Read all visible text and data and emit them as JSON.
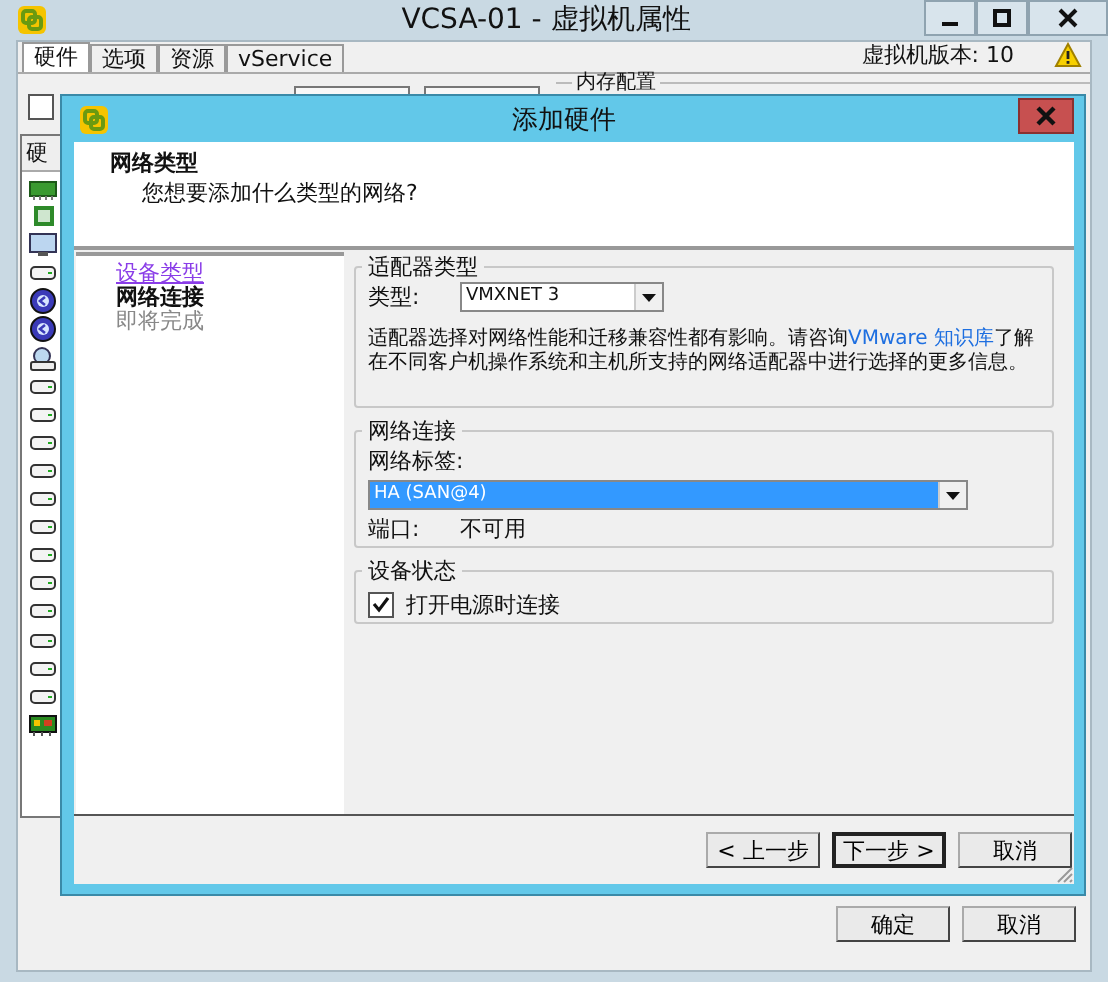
{
  "window": {
    "title": "VCSA-01 - 虚拟机属性"
  },
  "tabs": [
    {
      "label": "硬件",
      "selected": true
    },
    {
      "label": "选项",
      "selected": false
    },
    {
      "label": "资源",
      "selected": false
    },
    {
      "label": "vService",
      "selected": false
    }
  ],
  "vm_version": "虚拟机版本: 10",
  "show_all_checkbox": {
    "checked": false
  },
  "memory_group": {
    "legend": "内存配置"
  },
  "hardware_list": {
    "header": "硬",
    "devices": [
      {
        "kind": "memory"
      },
      {
        "kind": "cpu"
      },
      {
        "kind": "display"
      },
      {
        "kind": "disk"
      },
      {
        "kind": "cdrom"
      },
      {
        "kind": "cdrom"
      },
      {
        "kind": "floppy"
      },
      {
        "kind": "disk"
      },
      {
        "kind": "disk"
      },
      {
        "kind": "disk"
      },
      {
        "kind": "disk"
      },
      {
        "kind": "disk"
      },
      {
        "kind": "disk"
      },
      {
        "kind": "disk"
      },
      {
        "kind": "disk"
      },
      {
        "kind": "disk"
      },
      {
        "kind": "disk"
      },
      {
        "kind": "disk"
      },
      {
        "kind": "disk"
      },
      {
        "kind": "nic"
      }
    ]
  },
  "dialog": {
    "title": "添加硬件",
    "header": {
      "title": "网络类型",
      "subtitle": "您想要添加什么类型的网络?"
    },
    "steps": [
      {
        "label": "设备类型",
        "selected": false,
        "visited": true
      },
      {
        "label": "网络连接",
        "selected": true,
        "visited": false
      },
      {
        "label": "即将完成",
        "selected": false,
        "visited": false
      }
    ],
    "adapter_group": {
      "legend": "适配器类型",
      "type_label": "类型:",
      "type_value": "VMXNET 3",
      "description_before": "适配器选择对网络性能和迁移兼容性都有影响。请咨询",
      "description_link": "VMware 知识库",
      "description_after": "了解在不同客户机操作系统和主机所支持的网络适配器中进行选择的更多信息。"
    },
    "network_group": {
      "legend": "网络连接",
      "label": "网络标签:",
      "value": "HA (SAN@4)",
      "focused": true,
      "port_label": "端口:",
      "port_value": "不可用"
    },
    "status_group": {
      "legend": "设备状态",
      "connect_label": "打开电源时连接",
      "checked": true
    },
    "buttons": [
      {
        "label": "< 上一步",
        "kind": "normal"
      },
      {
        "label": "下一步 >",
        "kind": "default"
      },
      {
        "label": "取消",
        "kind": "normal"
      }
    ]
  },
  "buttons": [
    {
      "label": "确定"
    },
    {
      "label": "取消"
    }
  ]
}
